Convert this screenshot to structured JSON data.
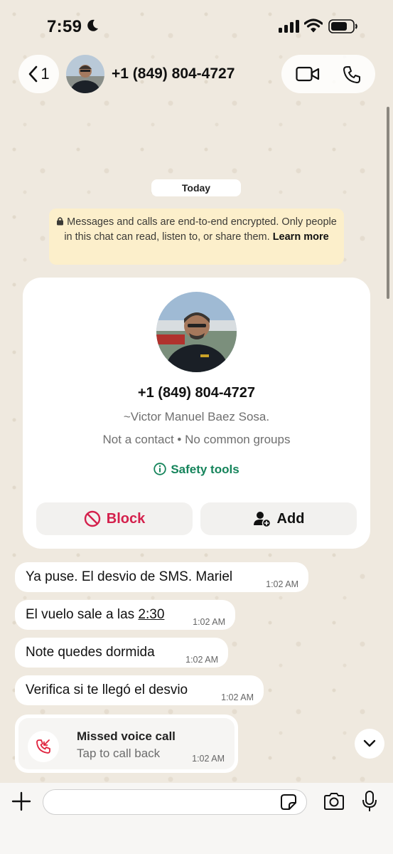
{
  "status_bar": {
    "time": "7:59"
  },
  "header": {
    "back_count": "1",
    "contact_title": "+1 (849) 804-4727"
  },
  "chat": {
    "date_chip": "Today",
    "encryption_notice": "Messages and calls are end-to-end encrypted. Only people in this chat can read, listen to, or share them.",
    "learn_more": "Learn more"
  },
  "contact_card": {
    "phone": "+1 (849) 804-4727",
    "name": "~Victor Manuel Baez Sosa.",
    "status": "Not a contact • No common groups",
    "safety_tools": "Safety tools",
    "block_label": "Block",
    "add_label": "Add"
  },
  "messages": [
    {
      "text": "Ya puse. El desvio de SMS. Mariel",
      "time": "1:02 AM"
    },
    {
      "text_before": "El vuelo sale a las ",
      "text_link": "2:30",
      "time": "1:02 AM"
    },
    {
      "text": "Note quedes dormida",
      "time": "1:02 AM"
    },
    {
      "text": "Verifica si te llegó el desvio",
      "time": "1:02 AM"
    }
  ],
  "missed_call": {
    "title": "Missed voice call",
    "subtitle": "Tap to call back",
    "time": "1:02 AM"
  },
  "input": {
    "placeholder": ""
  },
  "colors": {
    "accent_green": "#15845b",
    "block_red": "#d4204c",
    "notice_bg": "#fcefcb",
    "missed_red": "#e0243f"
  },
  "icons": [
    "moon-icon",
    "signal-icon",
    "wifi-icon",
    "battery-icon",
    "chevron-left-icon",
    "video-call-icon",
    "phone-icon",
    "lock-icon",
    "info-icon",
    "block-icon",
    "add-person-icon",
    "missed-call-icon",
    "chevron-down-icon",
    "plus-icon",
    "sticker-icon",
    "camera-icon",
    "microphone-icon"
  ]
}
